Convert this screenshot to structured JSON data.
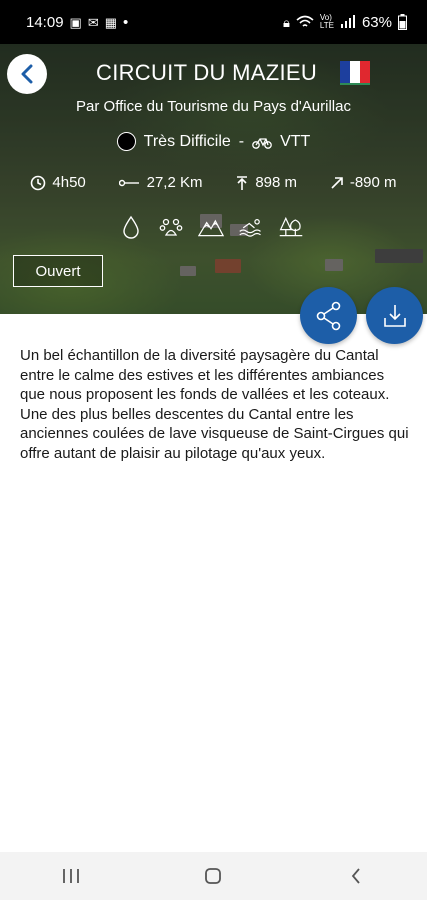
{
  "status_bar": {
    "time": "14:09",
    "dot": "•",
    "battery": "63%",
    "icons": [
      "gallery-icon",
      "mail-icon",
      "calendar-icon",
      "lock-icon",
      "wifi-icon",
      "volte-icon",
      "signal-icon",
      "battery-icon"
    ]
  },
  "header": {
    "title": "CIRCUIT DU MAZIEU",
    "subtitle": "Par Office du Tourisme du Pays d'Aurillac",
    "difficulty": "Très Difficile",
    "separator": "-",
    "activity": "VTT",
    "flag_colors": [
      "#1d3f9e",
      "#ffffff",
      "#e0282f"
    ]
  },
  "stats": {
    "duration": "4h50",
    "distance": "27,2 Km",
    "elevation_gain": "898 m",
    "elevation_loss": "-890 m"
  },
  "amenities": [
    "water-icon",
    "animal-icon",
    "mountain-icon",
    "swimming-icon",
    "forest-icon"
  ],
  "status": {
    "label": "Ouvert"
  },
  "actions": {
    "share_color": "#1d5ea8",
    "download_color": "#1d5ea8"
  },
  "description": "Un bel échantillon de la diversité paysagère du Cantal entre le calme des estives et les différentes ambiances que nous proposent les fonds de vallées et les coteaux. Une des plus belles descentes du Cantal entre les anciennes coulées de lave visqueuse de Saint-Cirgues qui offre autant de plaisir au pilotage qu'aux yeux."
}
